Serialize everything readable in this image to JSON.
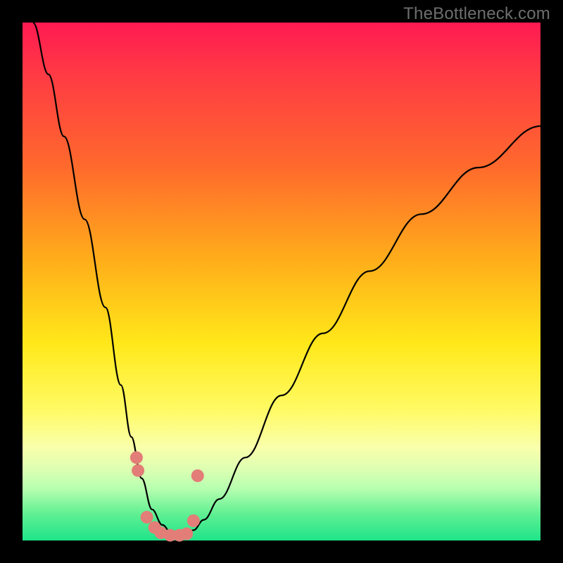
{
  "watermark": "TheBottleneck.com",
  "colors": {
    "frame": "#000000",
    "marker": "#e37d77",
    "curve": "#000000",
    "gradient_top": "#ff1a52",
    "gradient_mid": "#ffe81a",
    "gradient_bottom": "#1fe48a"
  },
  "chart_data": {
    "type": "line",
    "title": "",
    "xlabel": "",
    "ylabel": "",
    "xlim": [
      0,
      100
    ],
    "ylim": [
      0,
      100
    ],
    "grid": false,
    "legend": false,
    "annotations": [
      "TheBottleneck.com"
    ],
    "series": [
      {
        "name": "bottleneck-curve",
        "x": [
          2,
          5,
          8,
          12,
          16,
          19,
          21,
          23,
          25,
          27,
          29,
          31,
          33,
          35,
          38,
          43,
          50,
          58,
          67,
          77,
          88,
          100
        ],
        "values": [
          100,
          90,
          78,
          62,
          45,
          30,
          20,
          12,
          6,
          3,
          1,
          1,
          2,
          4,
          8,
          16,
          28,
          40,
          52,
          63,
          72,
          80
        ]
      }
    ],
    "markers": {
      "name": "marker-dots",
      "x": [
        22.0,
        22.3,
        24.0,
        25.5,
        26.7,
        28.5,
        30.3,
        31.7,
        33.0,
        33.8
      ],
      "values": [
        16.0,
        13.5,
        4.5,
        2.5,
        1.5,
        1.0,
        1.0,
        1.3,
        3.8,
        12.5
      ]
    }
  }
}
